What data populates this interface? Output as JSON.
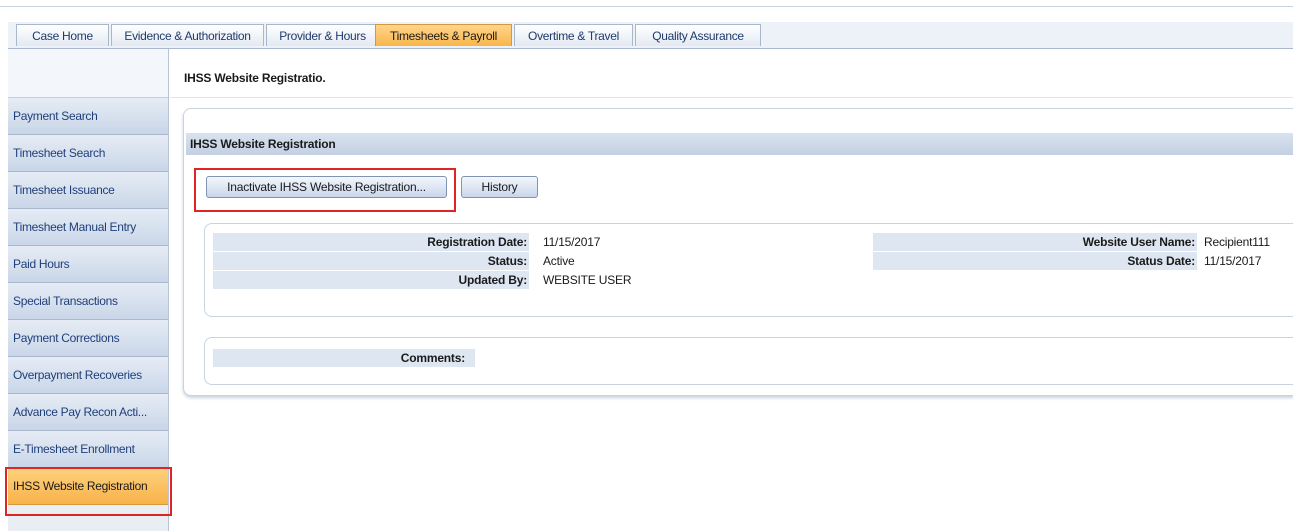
{
  "tabs": [
    {
      "label": "Case Home"
    },
    {
      "label": "Evidence & Authorization"
    },
    {
      "label": "Provider & Hours"
    },
    {
      "label": "Timesheets & Payroll"
    },
    {
      "label": "Overtime & Travel"
    },
    {
      "label": "Quality Assurance"
    }
  ],
  "sidebar": {
    "items": [
      {
        "label": "Payment Search"
      },
      {
        "label": "Timesheet Search"
      },
      {
        "label": "Timesheet Issuance"
      },
      {
        "label": "Timesheet Manual Entry"
      },
      {
        "label": "Paid Hours"
      },
      {
        "label": "Special Transactions"
      },
      {
        "label": "Payment Corrections"
      },
      {
        "label": "Overpayment Recoveries"
      },
      {
        "label": "Advance Pay Recon Acti..."
      },
      {
        "label": "E-Timesheet Enrollment"
      },
      {
        "label": "IHSS Website Registration"
      }
    ]
  },
  "header": {
    "title": "IHSS Website Registratio."
  },
  "section": {
    "title": "IHSS Website Registration"
  },
  "actions": {
    "inactivate_label": "Inactivate IHSS Website Registration...",
    "history_label": "History"
  },
  "details": {
    "registration_date_label": "Registration Date:",
    "registration_date": "11/15/2017",
    "status_label": "Status:",
    "status": "Active",
    "updated_by_label": "Updated By:",
    "updated_by": "WEBSITE USER",
    "website_user_name_label": "Website User Name:",
    "website_user_name": "Recipient111",
    "status_date_label": "Status Date:",
    "status_date": "11/15/2017"
  },
  "comments": {
    "label": "Comments:",
    "value": ""
  },
  "colors": {
    "active_tab": "#f8b64b",
    "highlight": "#e02424",
    "nav_bg": "#c9d6e8"
  }
}
